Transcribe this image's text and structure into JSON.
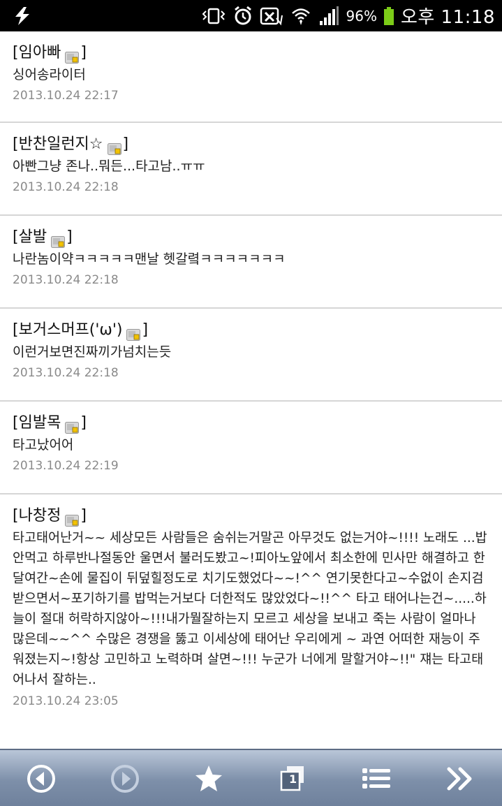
{
  "status_bar": {
    "battery_percent": "96%",
    "time": "오후 11:18",
    "battery_level": 0.96,
    "icons": [
      "usb-debug-icon",
      "vibrate-icon",
      "alarm-icon",
      "data-icon",
      "wifi-icon",
      "signal-icon",
      "battery-icon"
    ]
  },
  "comments": [
    {
      "author": "임아빠",
      "text": "싱어송라이터",
      "date": "2013.10.24 22:17"
    },
    {
      "author": "반찬일런지☆",
      "text": "아빤그냥 존나..뭐든...타고남..ㅠㅠ",
      "date": "2013.10.24 22:18"
    },
    {
      "author": "살발",
      "text": "나란놈이약ㅋㅋㅋㅋㅋ맨날 헷갈렼ㅋㅋㅋㅋㅋㅋㅋ",
      "date": "2013.10.24 22:18"
    },
    {
      "author": "보거스머프('ω')",
      "text": "이런거보면진짜끼가넘치는듯",
      "date": "2013.10.24 22:18"
    },
    {
      "author": "임발목",
      "text": "타고났어어",
      "date": "2013.10.24 22:19"
    },
    {
      "author": "나창정",
      "text": "타고태어난거~~ 세상모든 사람들은 숨쉬는거말곤 아무것도 없는거야~!!!! 노래도 ...밥안먹고 하루반나절동안 울면서 불러도봤고~!피아노앞에서 최소한에 민사만 해결하고 한달여간~손에 물집이 뒤덮힐정도로 치기도했었다~~!^^ 연기못한다고~수없이 손지검받으면서~포기하기를 밥먹는거보다 더한적도 많았었다~!!^^ 타고 태어나는건~.....하늘이 절대 허락하지않아~!!!내가뭘잘하는지 모르고 세상을 보내고 죽는 사람이 얼마나 많은데~~^^ 수많은 경쟁을 뚫고 이세상에 태어난 우리에게 ~ 과연 어떠한 재능이 주워졌는지~!항상 고민하고 노력하며 살면~!!! 누군가 너에게 말할거야~!!\" 쟤는 타고태어나서 잘하는..",
      "date": "2013.10.24 23:05"
    }
  ],
  "toolbar": {
    "buttons": [
      "back-icon",
      "forward-icon",
      "bookmark-star-icon",
      "windows-icon",
      "menu-list-icon",
      "more-icon"
    ],
    "windows_count": "1"
  }
}
